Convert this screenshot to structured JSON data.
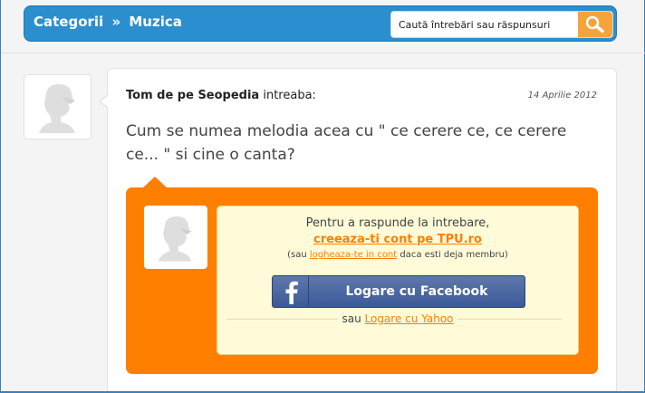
{
  "header": {
    "breadcrumb_root": "Categorii",
    "breadcrumb_separator": "»",
    "breadcrumb_current": "Muzica",
    "search_placeholder": "Caută întrebări sau răspunsuri",
    "search_icon": "magnifier-icon"
  },
  "question": {
    "author": "Tom de pe Seopedia",
    "verb": "intreaba:",
    "date": "14 Aprilie 2012",
    "text": "Cum se numea melodia acea cu \" ce cerere ce, ce cerere ce... \" si cine o canta?"
  },
  "answer_panel": {
    "line1": "Pentru a raspunde la intrebare,",
    "create_account": "creeaza-ti cont pe TPU.ro",
    "line3_prefix": "(sau ",
    "login_link": "logheaza-te in cont",
    "line3_suffix": " daca esti deja membru)",
    "facebook_button": "Logare cu Facebook",
    "yahoo_prefix": "sau ",
    "yahoo_link": "Logare cu Yahoo"
  },
  "colors": {
    "header_bg": "#2b8fcf",
    "accent_orange": "#ff7f00",
    "facebook_blue": "#3b5998",
    "panel_bg": "#fffbd8"
  }
}
